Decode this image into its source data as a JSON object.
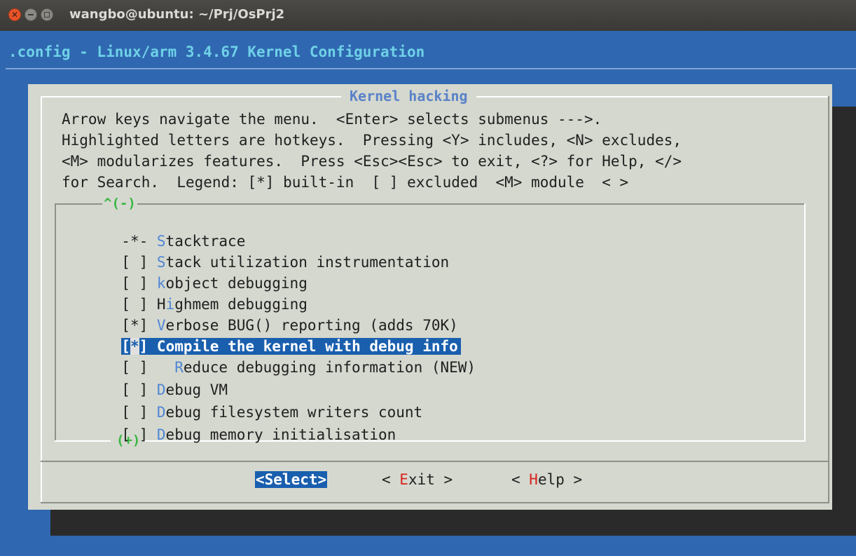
{
  "window": {
    "title": "wangbo@ubuntu: ~/Prj/OsPrj2",
    "close_glyph": "✕"
  },
  "config_header": ".config - Linux/arm 3.4.67 Kernel Configuration",
  "dialog": {
    "title": "Kernel hacking",
    "help_lines": [
      "Arrow keys navigate the menu.  <Enter> selects submenus --->.",
      "Highlighted letters are hotkeys.  Pressing <Y> includes, <N> excludes,",
      "<M> modularizes features.  Press <Esc><Esc> to exit, <?> for Help, </>",
      "for Search.  Legend: [*] built-in  [ ] excluded  <M> module  < >"
    ],
    "scroll_up": "^(-)",
    "scroll_down": "(+)",
    "items": [
      {
        "box": "-*-",
        "hotkey": "S",
        "rest": "tacktrace"
      },
      {
        "box": "[ ]",
        "hotkey": "S",
        "rest": "tack utilization instrumentation"
      },
      {
        "box": "[ ]",
        "hotkey": "k",
        "rest": "object debugging"
      },
      {
        "box": "[ ]",
        "pre": "H",
        "hotkey": "i",
        "rest": "ghmem debugging"
      },
      {
        "box": "[*]",
        "hotkey": "V",
        "rest": "erbose BUG() reporting (adds 70K)"
      },
      {
        "box_left": "[",
        "box_cursor": "*",
        "box_right": "]",
        "text": "Compile the kernel with debug info"
      },
      {
        "box": "[ ]",
        "indent": "  ",
        "hotkey": "R",
        "rest": "educe debugging information (NEW)"
      },
      {
        "box": "[ ]",
        "hotkey": "D",
        "rest": "ebug VM"
      },
      {
        "box": "[ ]",
        "hotkey": "D",
        "rest": "ebug filesystem writers count"
      },
      {
        "box": "[ ]",
        "hotkey": "D",
        "rest": "ebug memory initialisation"
      }
    ],
    "buttons": {
      "select": "<Select>",
      "exit_pre": "< ",
      "exit_hotkey": "E",
      "exit_rest": "xit >",
      "help_pre": "< ",
      "help_hotkey": "H",
      "help_rest": "elp >"
    }
  },
  "colors": {
    "terminal_bg": "#2f67b0",
    "dialog_bg": "#d5d8cf",
    "highlight": "#1a5fae",
    "hotkey": "#4f86d4",
    "scroll_indicator": "#37b640",
    "button_hotkey": "#d8241e"
  },
  "icons": [
    "close-icon",
    "minimize-icon",
    "maximize-icon"
  ]
}
